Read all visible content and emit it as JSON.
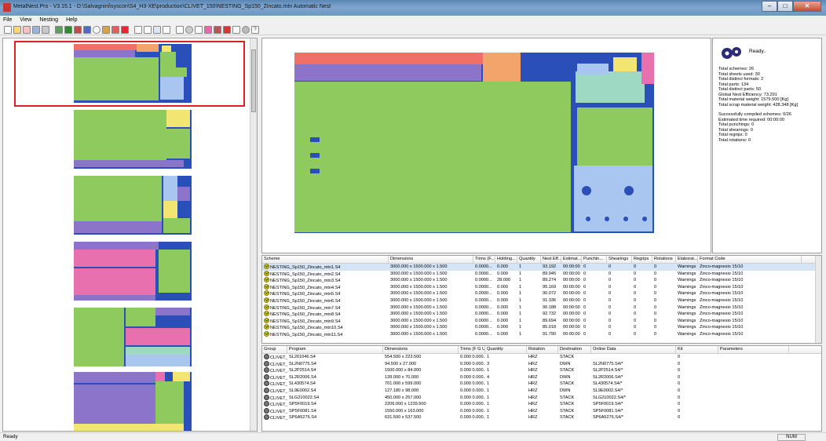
{
  "window": {
    "title": "MetalNest.Pro - V3.15.1 - D:\\Salvagnini\\syscon\\S4_H3-XE\\production\\CLIVET_150\\NESTING_Sp150_Zincato.mtn Automatic Nest"
  },
  "menu": [
    "File",
    "View",
    "Nesting",
    "Help"
  ],
  "info": {
    "status": "Ready..",
    "lines": [
      "Total schemes: 26",
      "Total sheets used: 30",
      "Total distinct formats: 2",
      "Total parts: 134",
      "Total distinct parts: 50",
      "Global Nest Efficiency: 73.291",
      "Total material weight: 1579.500 [Kg]",
      "Total scrap material weight: 428.348 [Kg]"
    ],
    "lines2": [
      "Successfully compiled schemes: 0/26",
      "Estimated time required: 00:00:00",
      "Total punchings: 0",
      "Total shearings: 0",
      "Total regrips: 0",
      "Total rotations: 0"
    ]
  },
  "schemes": {
    "headers": [
      "Scheme",
      "Dimensions",
      "Trims (F...",
      "Holding...",
      "Quantity",
      "Nest Eff...",
      "Estimat...",
      "Punchin...",
      "Shearings",
      "Regrips",
      "Rotations",
      "Elaborat...",
      "Format Code"
    ],
    "rows": [
      [
        "NESTING_Sp150_Zincato_mtn1.S4",
        "3000.000 x 1500.000 x 1.500",
        "0.0000...",
        "0.000",
        "1",
        "93.192",
        "00:00:00",
        "0",
        "0",
        "0",
        "0",
        "Warnings",
        "Zinco-magnesio 15/10"
      ],
      [
        "NESTING_Sp150_Zincato_mtn2.S4",
        "3000.000 x 1500.000 x 1.500",
        "0.0000...",
        "0.000",
        "1",
        "89.945",
        "00:00:00",
        "0",
        "0",
        "0",
        "0",
        "Warnings",
        "Zinco-magnesio 15/10"
      ],
      [
        "NESTING_Sp150_Zincato_mtn3.S4",
        "3000.000 x 1500.000 x 1.500",
        "0.0000...",
        "28.000",
        "1",
        "89.274",
        "00:00:00",
        "0",
        "0",
        "0",
        "0",
        "Warnings",
        "Zinco-magnesio 15/10"
      ],
      [
        "NESTING_Sp150_Zincato_mtn4.S4",
        "3000.000 x 1500.000 x 1.500",
        "0.0000...",
        "0.000",
        "1",
        "95.169",
        "00:00:00",
        "0",
        "0",
        "0",
        "0",
        "Warnings",
        "Zinco-magnesio 15/10"
      ],
      [
        "NESTING_Sp150_Zincato_mtn5.S4",
        "3000.000 x 1500.000 x 1.500",
        "0.0000...",
        "0.000",
        "1",
        "90.072",
        "00:00:00",
        "0",
        "0",
        "0",
        "0",
        "Warnings",
        "Zinco-magnesio 15/10"
      ],
      [
        "NESTING_Sp150_Zincato_mtn6.S4",
        "3000.000 x 1500.000 x 1.500",
        "0.0000...",
        "0.000",
        "1",
        "91.336",
        "00:00:00",
        "0",
        "0",
        "0",
        "0",
        "Warnings",
        "Zinco-magnesio 15/10"
      ],
      [
        "NESTING_Sp150_Zincato_mtn7.S4",
        "3000.000 x 1500.000 x 1.500",
        "0.0000...",
        "0.000",
        "1",
        "90.188",
        "00:00:00",
        "0",
        "0",
        "0",
        "0",
        "Warnings",
        "Zinco-magnesio 15/10"
      ],
      [
        "NESTING_Sp150_Zincato_mtn8.S4",
        "3000.000 x 1500.000 x 1.500",
        "0.0000...",
        "0.000",
        "1",
        "92.732",
        "00:00:00",
        "0",
        "0",
        "0",
        "0",
        "Warnings",
        "Zinco-magnesio 15/10"
      ],
      [
        "NESTING_Sp150_Zincato_mtn9.S4",
        "3000.000 x 1500.000 x 1.500",
        "0.0000...",
        "0.000",
        "1",
        "89.694",
        "00:00:00",
        "0",
        "0",
        "0",
        "0",
        "Warnings",
        "Zinco-magnesio 15/10"
      ],
      [
        "NESTING_Sp150_Zincato_mtn10.S4",
        "3000.000 x 1500.000 x 1.500",
        "0.0000...",
        "0.000",
        "1",
        "85.018",
        "00:00:00",
        "0",
        "0",
        "0",
        "0",
        "Warnings",
        "Zinco-magnesio 15/10"
      ],
      [
        "NESTING_Sp150_Zincato_mtn11.S4",
        "3000.000 x 1500.000 x 1.500",
        "0.0000...",
        "0.000",
        "1",
        "91.790",
        "00:00:00",
        "0",
        "0",
        "0",
        "0",
        "Warnings",
        "Zinco-magnesio 15/10"
      ]
    ]
  },
  "parts": {
    "headers": [
      "Group",
      "Program",
      "Dimensions",
      "Trims (F G U...",
      "Quantity",
      "Rotation",
      "Destination",
      "Online Data",
      "Kit",
      "Parameters"
    ],
    "rows": [
      [
        "CLIVET_1...",
        "SL261046.S4",
        "554.500 x 223.500",
        "0.000 0.000...",
        "1",
        "HRZ",
        "STACK",
        "",
        "0"
      ],
      [
        "CLIVET_1...",
        "SL2N0775.S4",
        "94.500 x 27.000",
        "0.000 0.000...",
        "3",
        "HRZ",
        "DWN",
        "SL2N0775.S4/*",
        "0"
      ],
      [
        "CLIVET_1...",
        "SL2P2514.S4",
        "1500.000 x 84.000",
        "0.000 0.000...",
        "1",
        "HRZ",
        "STACK",
        "SL2P2514.S4/*",
        "0"
      ],
      [
        "CLIVET_1...",
        "SL2R2006.S4",
        "139.000 x 70.000",
        "0.000 0.000...",
        "4",
        "HRZ",
        "DWN",
        "SL2R2006.S4/*",
        "0"
      ],
      [
        "CLIVET_1...",
        "SL430574.S4",
        "701.000 x 599.000",
        "0.000 0.000...",
        "1",
        "HRZ",
        "STACK",
        "SL430574.S4/*",
        "0"
      ],
      [
        "CLIVET_1...",
        "SL9E0002.S4",
        "127.180 x 98.000",
        "0.000 0.000...",
        "1",
        "HRZ",
        "DWN",
        "SL9E0002.S4/*",
        "0"
      ],
      [
        "CLIVET_1...",
        "SLG210022.S4",
        "450.000 x 257.000",
        "0.000 0.000...",
        "1",
        "HRZ",
        "STACK",
        "SLG210022.S4/*",
        "0"
      ],
      [
        "CLIVET_1...",
        "SP5F0019.S4",
        "2206.000 x 1239.500",
        "0.000 0.000...",
        "1",
        "HRZ",
        "STACK",
        "SP5F0019.S4/*",
        "0"
      ],
      [
        "CLIVET_1...",
        "SP5F0081.S4",
        "1550.000 x 163.000",
        "0.000 0.000...",
        "1",
        "HRZ",
        "STACK",
        "SP5F0081.S4/*",
        "0"
      ],
      [
        "CLIVET_1...",
        "SP6A5276.S4",
        "631.500 x 537.500",
        "0.000 0.000...",
        "1",
        "HRZ",
        "STACK",
        "SP6A5276.S4/*",
        "0"
      ]
    ]
  },
  "status": {
    "text": "Ready",
    "num": "NUM"
  },
  "colors": {
    "sheet": "#2b4fb8",
    "green": "#8fca5f",
    "pink": "#e970ae",
    "purple": "#8b74c9",
    "light_blue": "#a9c6f0",
    "yellow": "#f3e572",
    "red": "#f07068",
    "orange": "#f3a46b",
    "teal": "#9dd9c3"
  },
  "icons": [
    "new-icon",
    "open-icon",
    "save-icon",
    "cut-icon",
    "layers-icon",
    "nest-icon",
    "grid-icon",
    "help-icon",
    "gear-icon",
    "check-icon"
  ]
}
